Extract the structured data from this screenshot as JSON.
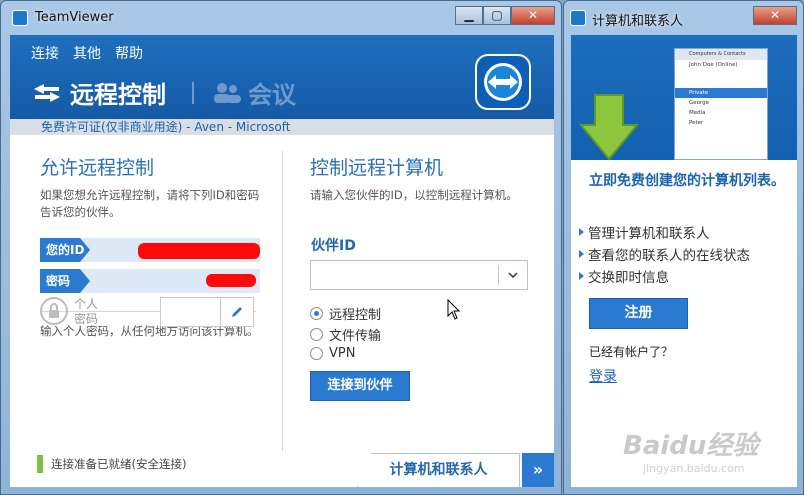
{
  "main_window": {
    "title": "TeamViewer",
    "menu": [
      "连接",
      "其他",
      "帮助"
    ],
    "tabs": {
      "remote": "远程控制",
      "meeting": "会议"
    },
    "license": "免费许可证(仅非商业用途) - Aven - Microsoft",
    "allow": {
      "heading": "允许远程控制",
      "description": "如果您想允许远程控制，请将下列ID和密码告诉您的伙伴。",
      "id_label": "您的ID",
      "password_label": "密码",
      "personal_hint": "输入个人密码，从任何地方访问该计算机。",
      "personal_label_1": "个人",
      "personal_label_2": "密码"
    },
    "control": {
      "heading": "控制远程计算机",
      "description": "请输入您伙伴的ID，以控制远程计算机。",
      "partner_label": "伙伴ID",
      "partner_value": "",
      "options": [
        {
          "label": "远程控制",
          "selected": true
        },
        {
          "label": "文件传输",
          "selected": false
        },
        {
          "label": "VPN",
          "selected": false
        }
      ],
      "connect_button": "连接到伙伴"
    },
    "status": "连接准备已就绪(安全连接)",
    "bottom_tab": "计算机和联系人",
    "bottom_tab_arrow": "»"
  },
  "side_window": {
    "title": "计算机和联系人",
    "mini": {
      "title": "Computers & Contacts",
      "user": "John Doe (Online)",
      "group": "Private",
      "contacts": [
        "George",
        "Media",
        "Peter"
      ]
    },
    "headline": "立即免费创建您的计算机列表。",
    "features": [
      "管理计算机和联系人",
      "查看您的联系人的在线状态",
      "交换即时信息"
    ],
    "register_button": "注册",
    "has_account": "已经有帐户了？",
    "login_link": "登录"
  },
  "watermark": {
    "text": "Baidu经验",
    "url": "jingyan.baidu.com"
  },
  "colors": {
    "accent": "#2b7ad1",
    "header": "#1e6fbd",
    "status_ok": "#7ac142",
    "redaction": "#ff0a0a"
  }
}
